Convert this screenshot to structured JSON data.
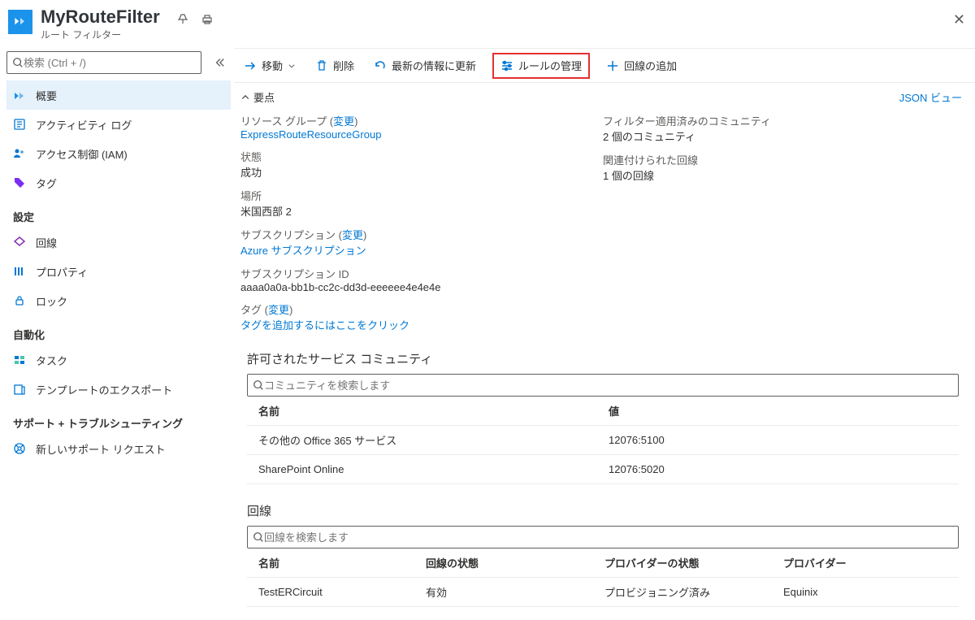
{
  "header": {
    "title": "MyRouteFilter",
    "subtitle": "ルート フィルター"
  },
  "sidebar": {
    "search_placeholder": "検索 (Ctrl + /)",
    "items": [
      "概要",
      "アクティビティ ログ",
      "アクセス制御 (IAM)",
      "タグ"
    ],
    "group_settings": "設定",
    "settings_items": [
      "回線",
      "プロパティ",
      "ロック"
    ],
    "group_auto": "自動化",
    "auto_items": [
      "タスク",
      "テンプレートのエクスポート"
    ],
    "group_support": "サポート + トラブルシューティング",
    "support_items": [
      "新しいサポート リクエスト"
    ]
  },
  "toolbar": {
    "move": "移動",
    "delete": "削除",
    "refresh": "最新の情報に更新",
    "manage": "ルールの管理",
    "add": "回線の追加"
  },
  "essentials": {
    "label": "要点",
    "json_view": "JSON ビュー",
    "left": [
      {
        "label": "リソース グループ (",
        "link": "変更",
        "suffix": ")",
        "value": "ExpressRouteResourceGroup",
        "vlink": true
      },
      {
        "label": "状態",
        "value": "成功"
      },
      {
        "label": "場所",
        "value": "米国西部 2"
      },
      {
        "label": "サブスクリプション (",
        "link": "変更",
        "suffix": ")",
        "value": "Azure サブスクリプション",
        "vlink": true
      },
      {
        "label": "サブスクリプション ID",
        "value": "aaaa0a0a-bb1b-cc2c-dd3d-eeeeee4e4e4e"
      },
      {
        "label": "タグ (",
        "link": "変更",
        "suffix": ")",
        "value": "タグを追加するにはここをクリック",
        "vlink": true
      }
    ],
    "right": [
      {
        "label": "フィルター適用済みのコミュニティ",
        "value": "2 個のコミュニティ"
      },
      {
        "label": "関連付けられた回線",
        "value": "1 個の回線"
      }
    ]
  },
  "communities": {
    "title": "許可されたサービス コミュニティ",
    "search_placeholder": "コミュニティを検索します",
    "cols": [
      "名前",
      "値"
    ],
    "rows": [
      {
        "name": "その他の Office 365 サービス",
        "value": "12076:5100"
      },
      {
        "name": "SharePoint Online",
        "value": "12076:5020"
      }
    ]
  },
  "circuits": {
    "title": "回線",
    "search_placeholder": "回線を検索します",
    "cols": [
      "名前",
      "回線の状態",
      "プロバイダーの状態",
      "プロバイダー"
    ],
    "rows": [
      {
        "name": "TestERCircuit",
        "cstate": "有効",
        "pstate": "プロビジョニング済み",
        "provider": "Equinix"
      }
    ]
  }
}
